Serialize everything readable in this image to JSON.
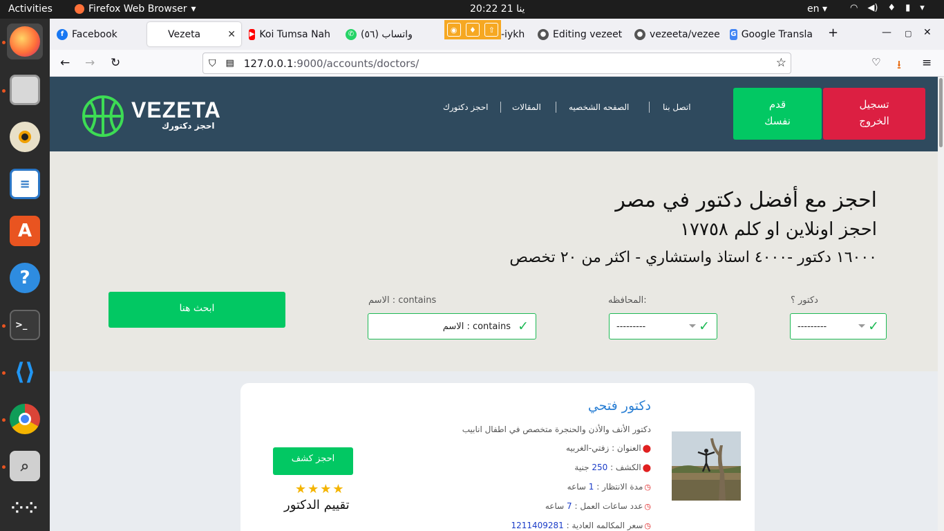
{
  "os": {
    "activities": "Activities",
    "app_name": "Firefox Web Browser",
    "clock": "20:22  21 ينا",
    "lang": "en"
  },
  "dock": [
    "firefox-icon",
    "files-icon",
    "rhythmbox-icon",
    "writer-icon",
    "software-icon",
    "help-icon",
    "terminal-icon",
    "vscode-icon",
    "chrome-icon",
    "screenshot-icon",
    "apps-grid-icon"
  ],
  "tabs": [
    {
      "label": "Facebook"
    },
    {
      "label": "Vezeta"
    },
    {
      "label": "Koi Tumsa Nah"
    },
    {
      "label": "واتساب (٥٦)"
    },
    {
      "label": "-iykh"
    },
    {
      "label": "Editing vezeet"
    },
    {
      "label": "vezeeta/vezee"
    },
    {
      "label": "Google Transla"
    }
  ],
  "url": {
    "host": "127.0.0.1",
    "path": ":9000/accounts/doctors/"
  },
  "header": {
    "logo_name": "VEZETA",
    "logo_sub": "احجز دكتورك",
    "menu": [
      "اتصل بنا",
      "الصفحه الشخصيه",
      "المقالات",
      "احجز دكتورك"
    ],
    "join": "قدم نفسك",
    "logout": "تسجيل الخروج"
  },
  "hero": {
    "title": "احجز مع أفضل دكتور في مصر",
    "subtitle": "احجز اونلاين او كلم ١٧٧٥٨",
    "stats": "١٦٠٠٠ دكتور -٤٠٠٠ استاذ واستشاري - اكثر من ٢٠ تخصص"
  },
  "filters": {
    "doctor_label": "دكتور ؟",
    "doctor_value": "---------",
    "gov_label": "المحافظه:",
    "gov_value": "---------",
    "name_label": "الاسم : contains",
    "name_value": "الاسم : contains",
    "search_btn": "ابحث هنا"
  },
  "card": {
    "name": "دكتور فتحي",
    "desc": "دكتور الأنف والأذن والحنجرة متخصص في اطفال انابيب",
    "address_label": "العنوان :",
    "address": "زفتي-الغربيه",
    "fee_label": "الكشف :",
    "fee_value": "250",
    "fee_unit": "جنية",
    "wait_label": "مدة الانتظار :",
    "wait_value": "1",
    "wait_unit": "ساعه",
    "hours_label": "عدد ساعات العمل :",
    "hours_value": "7",
    "hours_unit": "ساعه",
    "call_label": "سعر المكالمه العادية :",
    "call_value": "1211409281",
    "book_btn": "احجز كشف",
    "stars": "★★★★",
    "rating_label": "تقييم الدكتور",
    "rating": 4
  }
}
